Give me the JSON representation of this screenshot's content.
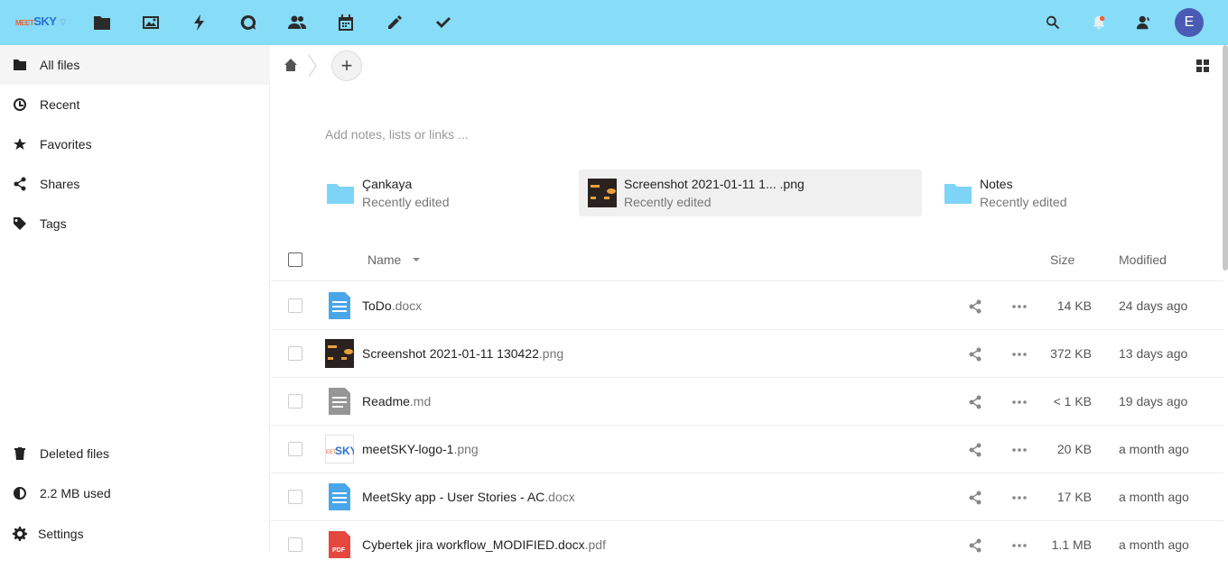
{
  "logo": {
    "m": "MEET",
    "s": "SKY",
    "c": "⌔"
  },
  "avatar": {
    "initial": "E"
  },
  "sidebar": {
    "items": [
      {
        "label": "All files"
      },
      {
        "label": "Recent"
      },
      {
        "label": "Favorites"
      },
      {
        "label": "Shares"
      },
      {
        "label": "Tags"
      }
    ],
    "bottom": [
      {
        "label": "Deleted files"
      },
      {
        "label": "2.2 MB used"
      },
      {
        "label": "Settings"
      }
    ]
  },
  "main": {
    "add_label": "+",
    "notes_placeholder": "Add notes, lists or links ...",
    "recent": [
      {
        "title": "Çankaya",
        "sub": "Recently edited"
      },
      {
        "title": "Screenshot 2021-01-11 1... .png",
        "sub": "Recently edited"
      },
      {
        "title": "Notes",
        "sub": "Recently edited"
      }
    ],
    "columns": {
      "name": "Name",
      "size": "Size",
      "modified": "Modified"
    },
    "files": [
      {
        "base": "ToDo",
        "ext": ".docx",
        "size": "14 KB",
        "modified": "24 days ago",
        "icon": "doc"
      },
      {
        "base": "Screenshot 2021-01-11 130422",
        "ext": ".png",
        "size": "372 KB",
        "modified": "13 days ago",
        "icon": "img"
      },
      {
        "base": "Readme",
        "ext": ".md",
        "size": "< 1 KB",
        "modified": "19 days ago",
        "icon": "text"
      },
      {
        "base": "meetSKY-logo-1",
        "ext": ".png",
        "size": "20 KB",
        "modified": "a month ago",
        "icon": "logo"
      },
      {
        "base": "MeetSky app - User Stories - AC",
        "ext": ".docx",
        "size": "17 KB",
        "modified": "a month ago",
        "icon": "doc"
      },
      {
        "base": "Cybertek jira workflow_MODIFIED.docx",
        "ext": ".pdf",
        "size": "1.1 MB",
        "modified": "a month ago",
        "icon": "pdf"
      }
    ]
  },
  "colors": {
    "topbar": "#87dcf7",
    "accent": "#4a5bb3",
    "folder": "#7dd4f7"
  }
}
